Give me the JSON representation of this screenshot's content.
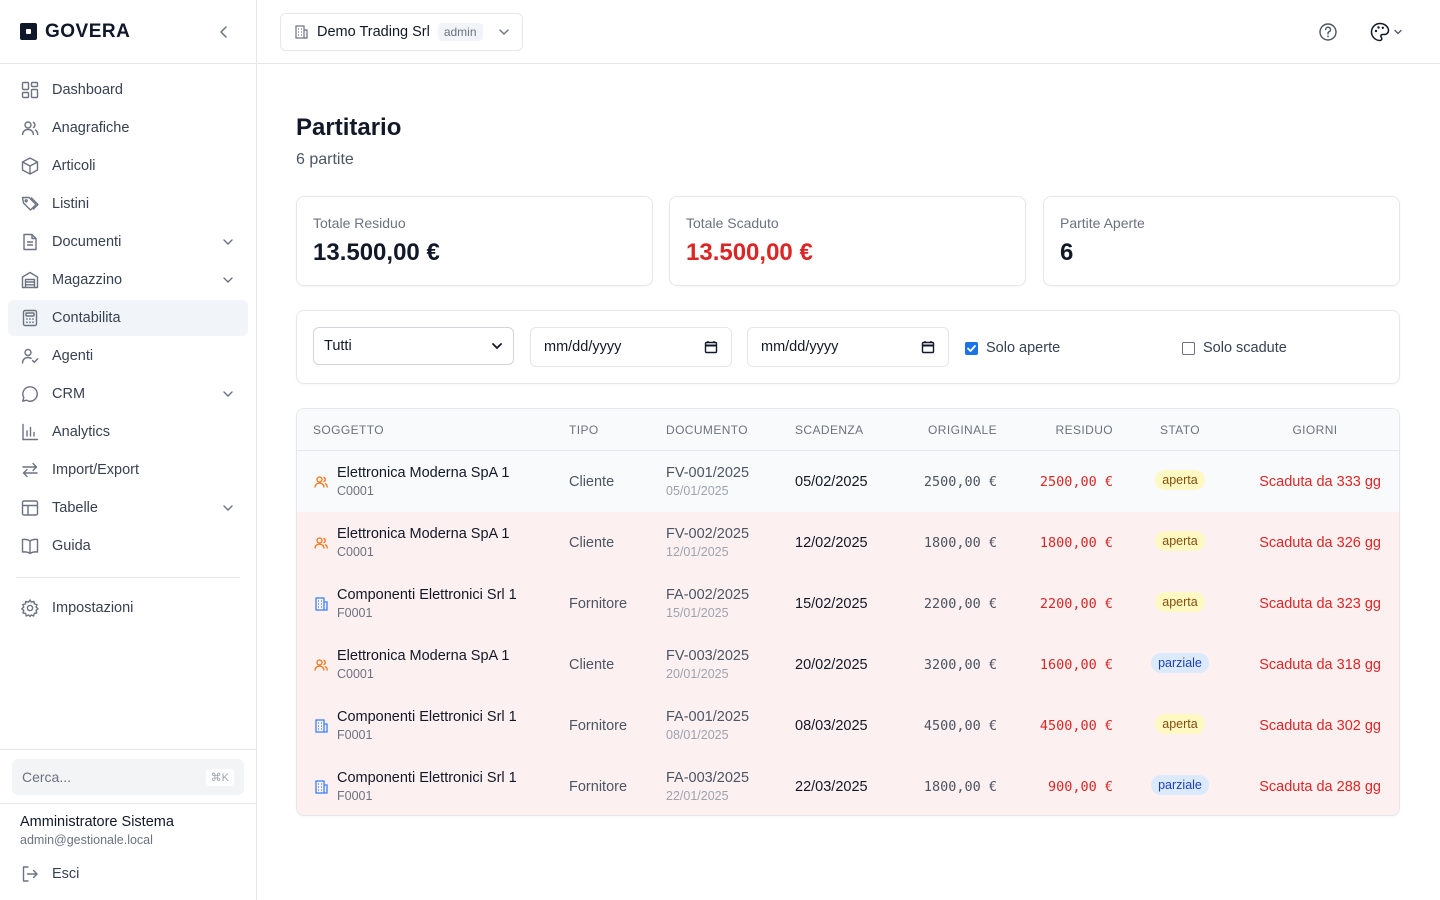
{
  "brand": {
    "name": "GOVERA"
  },
  "sidebar": {
    "items": [
      {
        "label": "Dashboard",
        "icon": "dashboard-icon",
        "expandable": false,
        "active": false
      },
      {
        "label": "Anagrafiche",
        "icon": "users-icon",
        "expandable": false,
        "active": false
      },
      {
        "label": "Articoli",
        "icon": "box-icon",
        "expandable": false,
        "active": false
      },
      {
        "label": "Listini",
        "icon": "tags-icon",
        "expandable": false,
        "active": false
      },
      {
        "label": "Documenti",
        "icon": "document-icon",
        "expandable": true,
        "active": false
      },
      {
        "label": "Magazzino",
        "icon": "warehouse-icon",
        "expandable": true,
        "active": false
      },
      {
        "label": "Contabilita",
        "icon": "calculator-icon",
        "expandable": false,
        "active": true
      },
      {
        "label": "Agenti",
        "icon": "agent-icon",
        "expandable": false,
        "active": false
      },
      {
        "label": "CRM",
        "icon": "chat-icon",
        "expandable": true,
        "active": false
      },
      {
        "label": "Analytics",
        "icon": "analytics-icon",
        "expandable": false,
        "active": false
      },
      {
        "label": "Import/Export",
        "icon": "swap-icon",
        "expandable": false,
        "active": false
      },
      {
        "label": "Tabelle",
        "icon": "table-icon",
        "expandable": true,
        "active": false
      },
      {
        "label": "Guida",
        "icon": "book-icon",
        "expandable": false,
        "active": false
      }
    ],
    "settings_label": "Impostazioni",
    "search_placeholder": "Cerca...",
    "search_shortcut": "⌘K",
    "user": {
      "name": "Amministratore Sistema",
      "email": "admin@gestionale.local"
    },
    "logout_label": "Esci"
  },
  "topbar": {
    "company": "Demo Trading Srl",
    "role": "admin"
  },
  "page": {
    "title": "Partitario",
    "subtitle": "6 partite"
  },
  "cards": [
    {
      "label": "Totale Residuo",
      "value": "13.500,00 €",
      "color": "#111827"
    },
    {
      "label": "Totale Scaduto",
      "value": "13.500,00 €",
      "color": "#dc2626"
    },
    {
      "label": "Partite Aperte",
      "value": "6",
      "color": "#111827"
    }
  ],
  "filters": {
    "type_select": "Tutti",
    "date_from": "mm/dd/yyyy",
    "date_to": "mm/dd/yyyy",
    "solo_aperte": {
      "label": "Solo aperte",
      "checked": true
    },
    "solo_scadute": {
      "label": "Solo scadute",
      "checked": false
    }
  },
  "table": {
    "headers": [
      "SOGGETTO",
      "TIPO",
      "DOCUMENTO",
      "SCADENZA",
      "ORIGINALE",
      "RESIDUO",
      "STATO",
      "GIORNI"
    ],
    "rows": [
      {
        "name": "Elettronica Moderna SpA 1",
        "code": "C0001",
        "kind": "client",
        "tipo": "Cliente",
        "doc": "FV-001/2025",
        "doc_date": "05/01/2025",
        "scadenza": "05/02/2025",
        "originale": "2500,00 €",
        "residuo": "2500,00 €",
        "stato": "aperta",
        "giorni": "Scaduta da 333 gg"
      },
      {
        "name": "Elettronica Moderna SpA 1",
        "code": "C0001",
        "kind": "client",
        "tipo": "Cliente",
        "doc": "FV-002/2025",
        "doc_date": "12/01/2025",
        "scadenza": "12/02/2025",
        "originale": "1800,00 €",
        "residuo": "1800,00 €",
        "stato": "aperta",
        "giorni": "Scaduta da 326 gg"
      },
      {
        "name": "Componenti Elettronici Srl 1",
        "code": "F0001",
        "kind": "supplier",
        "tipo": "Fornitore",
        "doc": "FA-002/2025",
        "doc_date": "15/01/2025",
        "scadenza": "15/02/2025",
        "originale": "2200,00 €",
        "residuo": "2200,00 €",
        "stato": "aperta",
        "giorni": "Scaduta da 323 gg"
      },
      {
        "name": "Elettronica Moderna SpA 1",
        "code": "C0001",
        "kind": "client",
        "tipo": "Cliente",
        "doc": "FV-003/2025",
        "doc_date": "20/01/2025",
        "scadenza": "20/02/2025",
        "originale": "3200,00 €",
        "residuo": "1600,00 €",
        "stato": "parziale",
        "giorni": "Scaduta da 318 gg"
      },
      {
        "name": "Componenti Elettronici Srl 1",
        "code": "F0001",
        "kind": "supplier",
        "tipo": "Fornitore",
        "doc": "FA-001/2025",
        "doc_date": "08/01/2025",
        "scadenza": "08/03/2025",
        "originale": "4500,00 €",
        "residuo": "4500,00 €",
        "stato": "aperta",
        "giorni": "Scaduta da 302 gg"
      },
      {
        "name": "Componenti Elettronici Srl 1",
        "code": "F0001",
        "kind": "supplier",
        "tipo": "Fornitore",
        "doc": "FA-003/2025",
        "doc_date": "22/01/2025",
        "scadenza": "22/03/2025",
        "originale": "1800,00 €",
        "residuo": "900,00 €",
        "stato": "parziale",
        "giorni": "Scaduta da 288 gg"
      }
    ]
  },
  "colors": {
    "accent_red": "#dc2626",
    "client_icon": "#f97316",
    "supplier_icon": "#3b82f6",
    "overdue_row": "#fdf0f0",
    "checkbox_blue": "#1a73e8"
  }
}
